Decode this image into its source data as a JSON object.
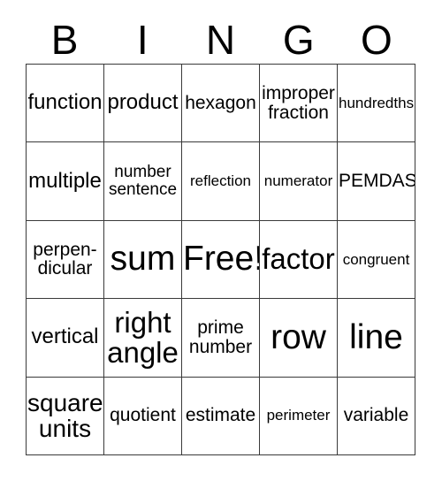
{
  "card": {
    "header_letters": [
      "B",
      "I",
      "N",
      "G",
      "O"
    ],
    "rows": [
      [
        {
          "text": "function",
          "size": "fs-xl"
        },
        {
          "text": "product",
          "size": "fs-xl"
        },
        {
          "text": "hexagon",
          "size": "fs-l"
        },
        {
          "text": "improper\nfraction",
          "size": "fs-l"
        },
        {
          "text": "hundredths",
          "size": "fs-s"
        }
      ],
      [
        {
          "text": "multiple",
          "size": "fs-xl"
        },
        {
          "text": "number\nsentence",
          "size": "fs-m"
        },
        {
          "text": "reflection",
          "size": "fs-s"
        },
        {
          "text": "numerator",
          "size": "fs-s"
        },
        {
          "text": "PEMDAS",
          "size": "fs-l"
        }
      ],
      [
        {
          "text": "perpen-\ndicular",
          "size": "fs-l"
        },
        {
          "text": "sum",
          "size": "fs-mega"
        },
        {
          "text": "Free!",
          "size": "fs-mega"
        },
        {
          "text": "factor",
          "size": "fs-huge"
        },
        {
          "text": "congruent",
          "size": "fs-s"
        }
      ],
      [
        {
          "text": "vertical",
          "size": "fs-xl"
        },
        {
          "text": "right\nangle",
          "size": "fs-huge"
        },
        {
          "text": "prime\nnumber",
          "size": "fs-l"
        },
        {
          "text": "row",
          "size": "fs-mega"
        },
        {
          "text": "line",
          "size": "fs-mega"
        }
      ],
      [
        {
          "text": "square\nunits",
          "size": "fs-xxl"
        },
        {
          "text": "quotient",
          "size": "fs-l"
        },
        {
          "text": "estimate",
          "size": "fs-l"
        },
        {
          "text": "perimeter",
          "size": "fs-s"
        },
        {
          "text": "variable",
          "size": "fs-l"
        }
      ]
    ]
  },
  "colors": {
    "background": "#ffffff",
    "text": "#000000",
    "grid_line": "#3a3a3a"
  }
}
